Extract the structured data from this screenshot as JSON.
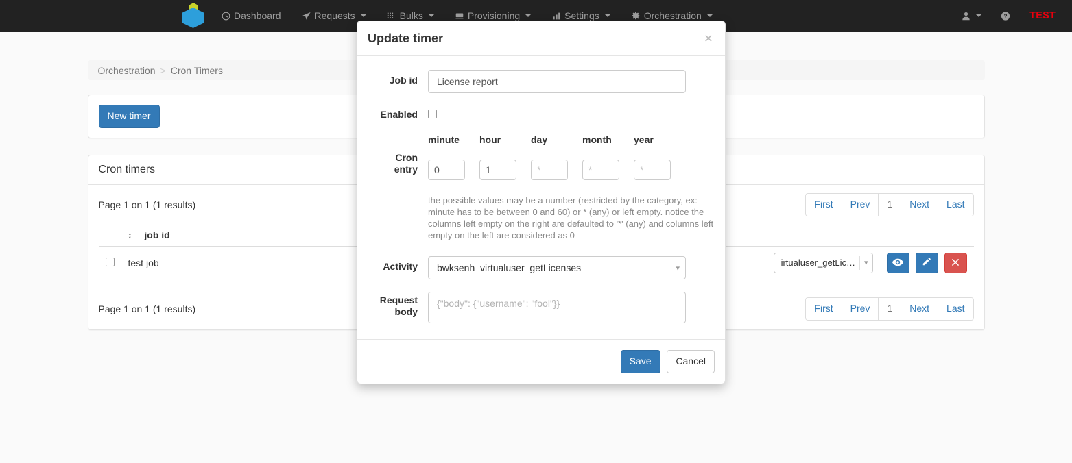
{
  "navbar": {
    "logo_name": "app-logo",
    "items": [
      {
        "label": "Dashboard",
        "icon": "clock-icon",
        "caret": false
      },
      {
        "label": "Requests",
        "icon": "paper-plane-icon",
        "caret": true
      },
      {
        "label": "Bulks",
        "icon": "grid-icon",
        "caret": true
      },
      {
        "label": "Provisioning",
        "icon": "server-icon",
        "caret": true
      },
      {
        "label": "Settings",
        "icon": "bar-chart-icon",
        "caret": true
      },
      {
        "label": "Orchestration",
        "icon": "gear-icon",
        "caret": true
      }
    ],
    "user_icon": "user-icon",
    "help_icon": "question-circle-icon",
    "environment_badge": "TEST",
    "badge_color": "#e8000d"
  },
  "breadcrumb": {
    "root": "Orchestration",
    "separator": ">",
    "current": "Cron Timers"
  },
  "toolbar": {
    "new_timer_label": "New timer"
  },
  "list_panel": {
    "heading": "Cron timers",
    "results_top": "Page 1 on 1 (1 results)",
    "results_bottom": "Page 1 on 1 (1 results)",
    "columns": [
      "",
      "job id"
    ],
    "rows": [
      {
        "checked": false,
        "job_id": "test job",
        "activity": "irtualuser_getLic…",
        "actions": [
          "view-icon",
          "edit-icon",
          "delete-icon"
        ]
      }
    ],
    "pager": [
      "First",
      "Prev",
      "1",
      "Next",
      "Last"
    ],
    "pager_active": "1"
  },
  "modal": {
    "title": "Update timer",
    "close_label": "×",
    "job_id": {
      "label": "Job id",
      "value": "License report",
      "placeholder": ""
    },
    "enabled": {
      "label": "Enabled",
      "checked": false
    },
    "cron": {
      "label_line1": "Cron",
      "label_line2": "entry",
      "headers": [
        "minute",
        "hour",
        "day",
        "month",
        "year"
      ],
      "values": [
        "0",
        "1",
        "",
        "",
        ""
      ],
      "placeholders": [
        "",
        "",
        "*",
        "*",
        "*"
      ],
      "help": "the possible values may be a number (restricted by the category, ex: minute has to be between 0 and 60) or * (any) or left empty. notice the columns left empty on the right are defaulted to '*' (any) and columns left empty on the left are considered as 0"
    },
    "activity": {
      "label": "Activity",
      "value": "bwksenh_virtualuser_getLicenses",
      "chevron_icon": "chevron-down-icon"
    },
    "request_body": {
      "label_line1": "Request",
      "label_line2": "body",
      "value": "",
      "placeholder": "{\"body\": {\"username\": \"fool\"}}"
    },
    "save_label": "Save",
    "cancel_label": "Cancel"
  },
  "colors": {
    "primary": "#337ab7",
    "danger": "#d9534f",
    "navbar_bg": "#222222",
    "logo_blue": "#2d9fdb",
    "logo_green": "#c9d22a"
  }
}
